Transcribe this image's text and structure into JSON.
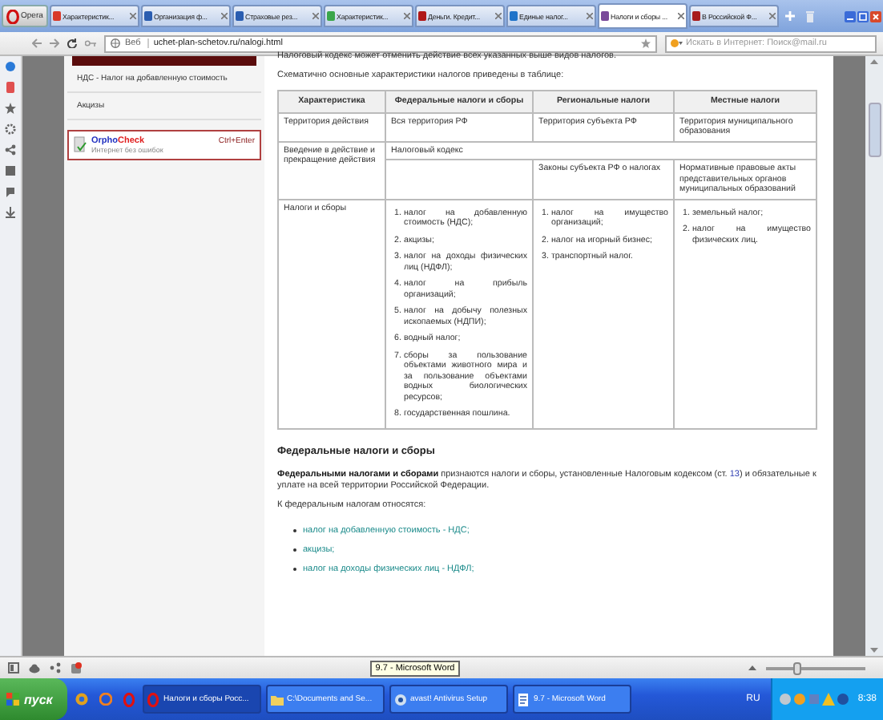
{
  "browser": {
    "menu_button": "Opera",
    "tabs": [
      {
        "label": "Характеристик...",
        "selected": false,
        "color": "#d83a2a"
      },
      {
        "label": "Организация ф...",
        "selected": false,
        "color": "#2a5db0"
      },
      {
        "label": "Страховые рез...",
        "selected": false,
        "color": "#2a5db0"
      },
      {
        "label": "Характеристик...",
        "selected": false,
        "color": "#3aa64a"
      },
      {
        "label": "Деньги. Кредит...",
        "selected": false,
        "color": "#b01818"
      },
      {
        "label": "Единые налог...",
        "selected": false,
        "color": "#1f73c9"
      },
      {
        "label": "Налоги и сборы ...",
        "selected": true,
        "color": "#7a4a9a"
      },
      {
        "label": "В Российской Ф...",
        "selected": false,
        "color": "#a81c1c"
      }
    ],
    "address": {
      "prefix": "Веб",
      "url": "uchet-plan-schetov.ru/nalogi.html"
    },
    "search": {
      "placeholder": "Искать в Интернет: Поиск@mail.ru"
    }
  },
  "sidebar": {
    "links": [
      "НДС - Налог на добавленную стоимость",
      "Акцизы"
    ],
    "orphocheck": {
      "brand_first": "Orpho",
      "brand_second": "Check",
      "shortcut": "Ctrl+Enter",
      "subtitle": "Интернет без ошибок"
    }
  },
  "article": {
    "top_line": "Налоговый кодекс может отменить действие всех указанных выше видов налогов.",
    "intro": "Схематично основные характеристики налогов приведены в таблице:",
    "table": {
      "columns": [
        "Характеристика",
        "Федеральные налоги и сборы",
        "Региональные налоги",
        "Местные налоги"
      ],
      "rows": [
        {
          "kind": "plain",
          "cells": [
            "Территория действия",
            "Вся территория РФ",
            "Территория субъекта РФ",
            "Территория муниципального образования"
          ]
        },
        {
          "kind": "split",
          "label": "Введение в действие и прекращение действия",
          "common": "Налоговый кодекс",
          "regional": "Законы субъекта РФ о налогах",
          "local": "Нормативные правовые акты представительных органов муниципальных образований"
        },
        {
          "kind": "lists",
          "label": "Налоги и сборы",
          "lists": [
            [
              {
                "number": "1.",
                "text": "налог на добавленную стоимость (НДС);"
              },
              {
                "number": "2.",
                "text": "акцизы;"
              },
              {
                "number": "3.",
                "text": "налог на доходы физических лиц (НДФЛ);"
              },
              {
                "number": "4.",
                "text": "налог на прибыль организаций;"
              },
              {
                "number": "5.",
                "text": "налог на добычу полезных ископаемых (НДПИ);"
              },
              {
                "number": "6.",
                "text": "водный налог;"
              },
              {
                "number": "7.",
                "text": "сборы за пользование объектами животного мира и за пользование объектами водных биологических ресурсов;"
              },
              {
                "number": "8.",
                "text": "государственная пошлина."
              }
            ],
            [
              {
                "number": "1.",
                "text": "налог на имущество организаций;"
              },
              {
                "number": "2.",
                "text": "налог на игорный бизнес;"
              },
              {
                "number": "3.",
                "text": "транспортный налог."
              }
            ],
            [
              {
                "number": "1.",
                "text": "земельный налог;"
              },
              {
                "number": "2.",
                "text": "налог на имущество физических лиц."
              }
            ]
          ]
        }
      ]
    },
    "heading": "Федеральные налоги и сборы",
    "paragraph": [
      {
        "kind": "text",
        "text": "**Федеральными налогами и сборами** признаются налоги и сборы, установленные Налоговым кодексом (ст. "
      },
      {
        "kind": "link",
        "text": "13"
      },
      {
        "kind": "text",
        "text": ") и обязательные к уплате на всей территории Российской Федерации."
      }
    ],
    "list_intro": "К федеральным налогам относятся:",
    "links": [
      "налог на добавленную стоимость - НДС;",
      "акцизы;",
      "налог на доходы физических лиц - НДФЛ;"
    ]
  },
  "status_bar": {
    "tooltip": "9.7 - Microsoft Word",
    "zoom": {
      "level": 0.3
    }
  },
  "taskbar": {
    "start": "пуск",
    "tasks": [
      {
        "label": "Налоги и сборы Росс...",
        "selected": true,
        "kind": "opera"
      },
      {
        "label": "C:\\Documents and Se...",
        "selected": false,
        "kind": "folder"
      },
      {
        "label": "avast! Antivirus Setup",
        "selected": false,
        "kind": "setup"
      },
      {
        "label": "9.7 - Microsoft Word",
        "selected": false,
        "kind": "word"
      }
    ],
    "language": "RU",
    "clock": "8:38"
  }
}
